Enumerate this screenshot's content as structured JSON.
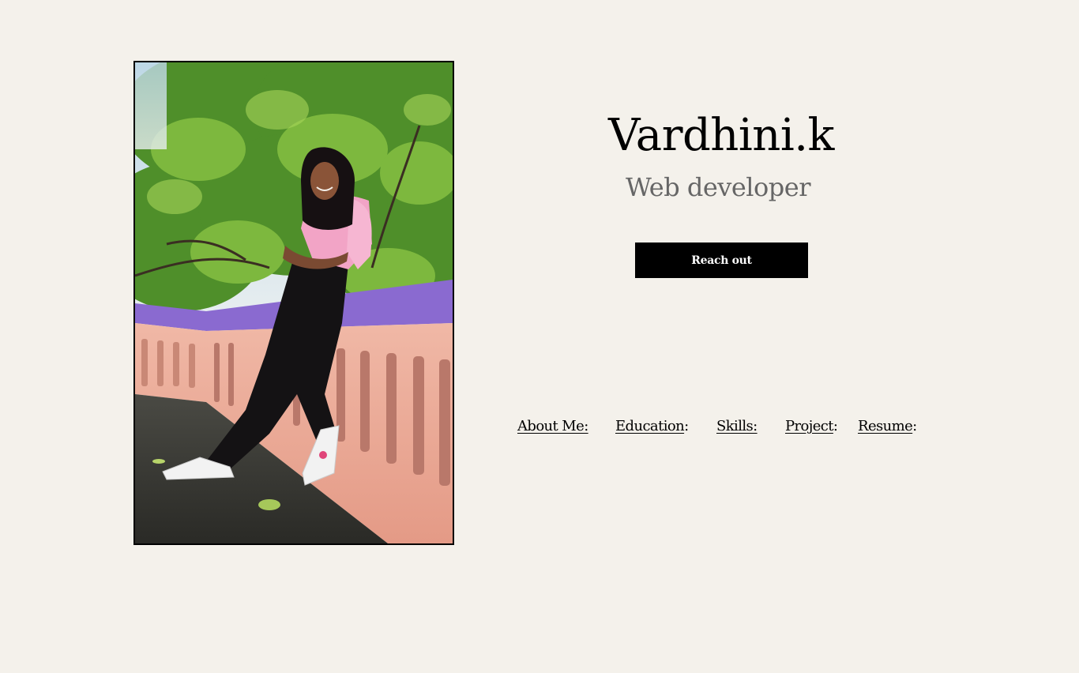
{
  "profile": {
    "name": "Vardhini.k",
    "role": "Web developer",
    "photo_alt": "portrait-photo"
  },
  "cta": {
    "label": "Reach out"
  },
  "nav": {
    "items": [
      {
        "label": "About Me:",
        "suffix": ""
      },
      {
        "label": "Education",
        "suffix": ":"
      },
      {
        "label": "Skills:",
        "suffix": ""
      },
      {
        "label": "Project",
        "suffix": ":"
      },
      {
        "label": "Resume",
        "suffix": ":"
      }
    ]
  },
  "colors": {
    "background": "#f4f1eb",
    "button_bg": "#000000",
    "button_text": "#ffffff",
    "subtitle": "#666666"
  }
}
